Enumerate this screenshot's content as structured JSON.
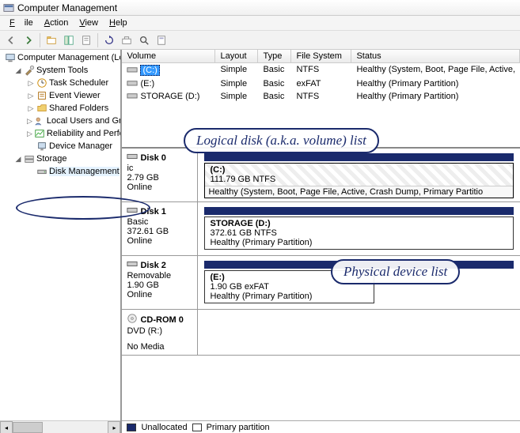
{
  "window": {
    "title": "Computer Management"
  },
  "menu": {
    "file": "File",
    "action": "Action",
    "view": "View",
    "help": "Help"
  },
  "tree": {
    "root": "Computer Management (Lo",
    "sys": "System Tools",
    "sched": "Task Scheduler",
    "event": "Event Viewer",
    "shared": "Shared Folders",
    "local": "Local Users and Grou",
    "reliab": "Reliability and Perfor",
    "devmgr": "Device Manager",
    "storage": "Storage",
    "diskmgmt": "Disk Management"
  },
  "cols": {
    "vol": "Volume",
    "layout": "Layout",
    "type": "Type",
    "fs": "File System",
    "status": "Status"
  },
  "vols": [
    {
      "icon": "drive",
      "name": "(C:)",
      "layout": "Simple",
      "type": "Basic",
      "fs": "NTFS",
      "status": "Healthy (System, Boot, Page File, Active,"
    },
    {
      "icon": "drive",
      "name": "(E:)",
      "layout": "Simple",
      "type": "Basic",
      "fs": "exFAT",
      "status": "Healthy (Primary Partition)"
    },
    {
      "icon": "drive",
      "name": "STORAGE (D:)",
      "layout": "Simple",
      "type": "Basic",
      "fs": "NTFS",
      "status": "Healthy (Primary Partition)"
    }
  ],
  "disks": [
    {
      "name": "Disk 0",
      "t2": "ic",
      "size": "2.79 GB",
      "state": "Online",
      "part": {
        "title": "(C:)",
        "sub": "111.79 GB NTFS",
        "status": "Healthy (System, Boot, Page File, Active, Crash Dump, Primary Partitio",
        "hatched": true
      }
    },
    {
      "name": "Disk 1",
      "t2": "Basic",
      "size": "372.61 GB",
      "state": "Online",
      "part": {
        "title": "STORAGE  (D:)",
        "sub": "372.61 GB NTFS",
        "status": "Healthy (Primary Partition)",
        "hatched": false
      }
    },
    {
      "name": "Disk 2",
      "t2": "Removable",
      "size": "1.90 GB",
      "state": "Online",
      "part": {
        "title": "(E:)",
        "sub": "1.90 GB exFAT",
        "status": "Healthy (Primary Partition)",
        "hatched": false
      }
    },
    {
      "name": "CD-ROM 0",
      "t2": "DVD (R:)",
      "size": "",
      "state": "No Media",
      "cd": true
    }
  ],
  "legend": {
    "unalloc": "Unallocated",
    "primary": "Primary partition"
  },
  "anno": {
    "vol_list": "Logical disk (a.k.a. volume) list",
    "phys_list": "Physical device list"
  }
}
